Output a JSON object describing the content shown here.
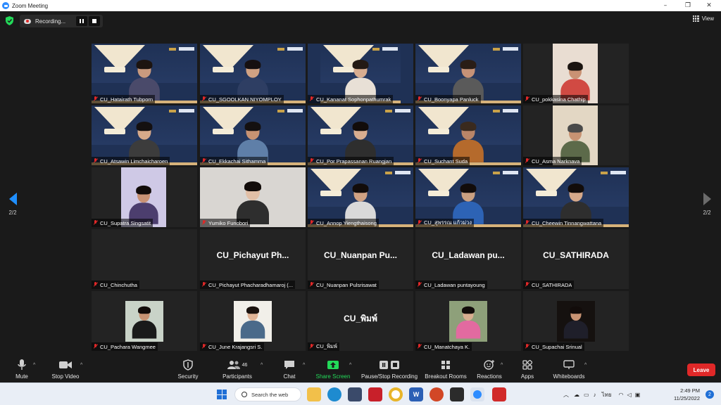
{
  "window": {
    "title": "Zoom Meeting",
    "minimize": "–",
    "restore": "❐",
    "close": "✕"
  },
  "topbar": {
    "recording_text": "Recording...",
    "view_label": "View"
  },
  "pagination": {
    "left": "2/2",
    "right": "2/2"
  },
  "participants": [
    {
      "name": "CU_Hatairath Tubporn",
      "kind": "slide",
      "skin": "#c99a7e",
      "hair": "#1c1410",
      "shirt": "#4a4a6a"
    },
    {
      "name": "CU_SGOOLKAN NIYOMPLOY",
      "kind": "slide",
      "skin": "#d0a283",
      "hair": "#161010",
      "shirt": "#2e3e63"
    },
    {
      "name": "CU_Kananat Sophonpathumrak",
      "kind": "slide-narrow",
      "skin": "#d8ad90",
      "hair": "#241a14",
      "shirt": "#e8e0d6"
    },
    {
      "name": "CU_Boonyapa Panluck",
      "kind": "slide",
      "skin": "#c69277",
      "hair": "#2a1d16",
      "shirt": "#5a5a5a"
    },
    {
      "name": "CU_pokkasina Chathip",
      "kind": "cam-inset",
      "bg": "#e9ddd2",
      "skin": "#c99274",
      "hair": "#1a1410",
      "shirt": "#d14a43"
    },
    {
      "name": "CU_Atsawin Limchaicharoen",
      "kind": "slide",
      "skin": "#d6a98a",
      "hair": "#141010",
      "shirt": "#3c3c3c"
    },
    {
      "name": "CU_Ekkachai Sithamma",
      "kind": "slide",
      "skin": "#c89373",
      "hair": "#141010",
      "shirt": "#5f7fa8"
    },
    {
      "name": "CU_Por Prapassanan Ruangjan",
      "kind": "slide",
      "skin": "#d8ad90",
      "hair": "#120c0a",
      "shirt": "#2e2e2e"
    },
    {
      "name": "CU_Suchant Suda",
      "kind": "slide",
      "skin": "#b98568",
      "hair": "#3a2a1e",
      "shirt": "#b56a2c"
    },
    {
      "name": "CU_Asma Narknava",
      "kind": "cam-inset",
      "bg": "#e3d7c4",
      "skin": "#c89373",
      "hair": "#4a4a4a",
      "shirt": "#5c6a4a"
    },
    {
      "name": "CU_Supatra Singsatit",
      "kind": "cam-inset",
      "bg": "#cfc9e6",
      "skin": "#c99274",
      "hair": "#120c0a",
      "shirt": "#4c3e6e"
    },
    {
      "name": "Yumiko Funobori",
      "kind": "cam-full",
      "bg": "#d9d6d2",
      "skin": "#e2bfa6",
      "hair": "#120c0a",
      "shirt": "#2e2e2e"
    },
    {
      "name": "CU_Annop Yiengthaisong",
      "kind": "slide",
      "skin": "#d0a283",
      "hair": "#120c0a",
      "shirt": "#d9d9d9"
    },
    {
      "name": "CU_สุพรรณ แก้วม่วง",
      "kind": "slide",
      "skin": "#caa081",
      "hair": "#120c0a",
      "shirt": "#2d63b5"
    },
    {
      "name": "CU_Cheewin Tinnangwattana",
      "kind": "slide",
      "skin": "#d6a98a",
      "hair": "#120c0a",
      "shirt": "#2e2e2e"
    },
    {
      "name": "CU_Chinchutha",
      "kind": "blank",
      "big": ""
    },
    {
      "name": "CU_Pichayut Phacharadhamaroj (...",
      "kind": "blank",
      "big": "CU_Pichayut Ph..."
    },
    {
      "name": "CU_Nuanpan Pulsrisawat",
      "kind": "blank",
      "big": "CU_Nuanpan Pu..."
    },
    {
      "name": "CU_Ladawan puntayoung",
      "kind": "blank",
      "big": "CU_Ladawan pu..."
    },
    {
      "name": "CU_SATHIRADA",
      "kind": "blank",
      "big": "CU_SATHIRADA"
    },
    {
      "name": "CU_Pachara Wangmee",
      "kind": "photo",
      "bg": "#c9d3c8",
      "skin": "#c89373",
      "hair": "#120c0a",
      "shirt": "#1a1a1a"
    },
    {
      "name": "CU_June Krajangsri S.",
      "kind": "photo",
      "bg": "#f1efe9",
      "skin": "#e0b496",
      "hair": "#1a120e",
      "shirt": "#4a6a8a"
    },
    {
      "name": "CU_พิมพ์",
      "kind": "blank",
      "big": "CU_พิมพ์"
    },
    {
      "name": "CU_Manatchaya K.",
      "kind": "photo",
      "bg": "#8ea07a",
      "skin": "#d8ad90",
      "hair": "#120c0a",
      "shirt": "#e26aa0"
    },
    {
      "name": "CU_Supachai Srinual",
      "kind": "photo",
      "bg": "#15110f",
      "skin": "#c89373",
      "hair": "#120c0a",
      "shirt": "#1f1f2a"
    }
  ],
  "toolbar": {
    "mute": "Mute",
    "stop_video": "Stop Video",
    "security": "Security",
    "participants": "Participants",
    "participants_count": "46",
    "chat": "Chat",
    "share_screen": "Share Screen",
    "pause_stop_recording": "Pause/Stop Recording",
    "breakout_rooms": "Breakout Rooms",
    "reactions": "Reactions",
    "apps": "Apps",
    "whiteboards": "Whiteboards",
    "leave": "Leave"
  },
  "taskbar": {
    "search_placeholder": "Search the web",
    "language": "ไทย",
    "time": "2:49 PM",
    "date": "11/25/2022",
    "notifications": "2"
  },
  "colors": {
    "accent_green": "#23d959",
    "leave_red": "#e02828",
    "pager_blue": "#1f8fff",
    "pager_gray": "#6b6b6b"
  }
}
